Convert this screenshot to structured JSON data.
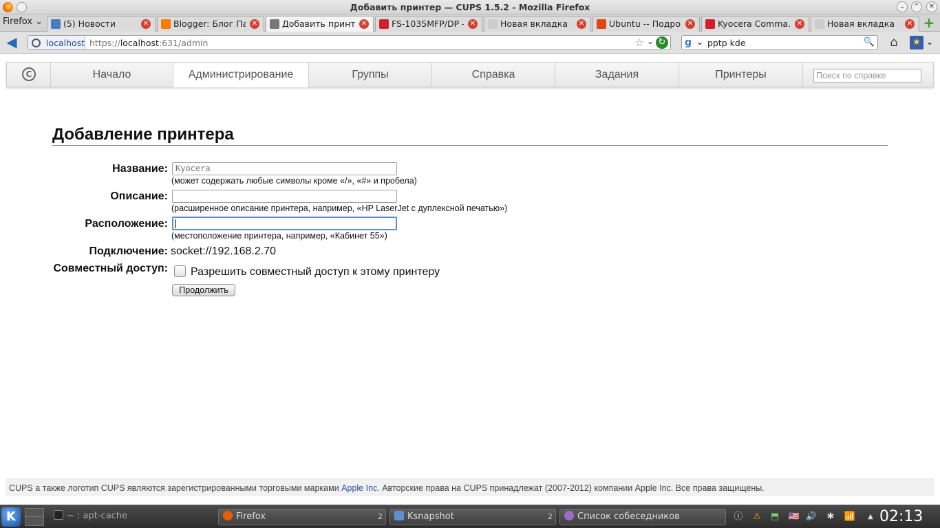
{
  "window": {
    "title": "Добавить принтер — CUPS 1.5.2 - Mozilla Firefox",
    "buttons": [
      "⌄",
      "⌃",
      "✕"
    ]
  },
  "tabs": {
    "menu_label": "Firefox ⌄",
    "items": [
      {
        "label": "(5) Новости",
        "favicon_color": "#4b7bc5"
      },
      {
        "label": "Blogger: Блог Па…",
        "favicon_color": "#f57d00"
      },
      {
        "label": "Добавить принт…",
        "favicon_color": "#777777"
      },
      {
        "label": "FS-1035MFP/DP -…",
        "favicon_color": "#d0202a"
      },
      {
        "label": "Новая вкладка",
        "favicon_color": "#cccccc"
      },
      {
        "label": "Ubuntu -- Подро…",
        "favicon_color": "#dd4814"
      },
      {
        "label": "Kyocera Comma…",
        "favicon_color": "#d0202a"
      },
      {
        "label": "Новая вкладка",
        "favicon_color": "#cccccc"
      }
    ],
    "close_glyph": "✕",
    "new_tab_glyph": "+"
  },
  "navbar": {
    "back_icon": "◀",
    "identity_host": "localhost",
    "url_scheme": "https://",
    "url_host": "localhost",
    "url_rest": ":631/admin",
    "star_icon": "☆",
    "drop_icon": "⌄",
    "reload_icon": "↻",
    "search_engine_icon": "g",
    "search_query": "pptp kde",
    "search_go_icon": "🔍",
    "home_icon": "⌂",
    "bookmarks_icon": "★"
  },
  "cups_nav": {
    "items": [
      "Начало",
      "Администрирование",
      "Группы",
      "Справка",
      "Задания",
      "Принтеры"
    ],
    "active_index": 1,
    "search_placeholder": "Поиск по справке"
  },
  "form": {
    "heading": "Добавление принтера",
    "name_label": "Название:",
    "name_value": "Kyocera",
    "name_hint": "(может содержать любые символы кроме «/», «#» и пробела)",
    "description_label": "Описание:",
    "description_value": "",
    "description_hint": "(расширенное описание принтера, например, «HP LaserJet с дуплексной печатью»)",
    "location_label": "Расположение:",
    "location_value": "",
    "location_hint": "(местоположение принтера, например, «Кабинет 55»)",
    "connection_label": "Подключение:",
    "connection_value": "socket://192.168.2.70",
    "sharing_label": "Совместный доступ:",
    "sharing_checkbox_label": "Разрешить совместный доступ к этому принтеру",
    "sharing_checked": false,
    "continue_button": "Продолжить"
  },
  "footer": {
    "text_before": "CUPS а также логотип CUPS являются зарегистрированными торговыми марками ",
    "link": "Apple Inc.",
    "text_after": " Авторские права на CUPS принадлежат (2007-2012) компании Apple Inc. Все права защищены."
  },
  "taskbar": {
    "kmenu_icon": "K",
    "tasks": [
      {
        "label": "~ : apt-cache",
        "icon_color": "#222222"
      },
      {
        "label": "Firefox",
        "icon_color": "#e66000",
        "count": "2"
      },
      {
        "label": "Ksnapshot",
        "icon_color": "#5b8fd3",
        "count": "2"
      },
      {
        "label": "Список собеседников",
        "icon_color": "#9b6cc9"
      }
    ],
    "tray_icons": [
      "ⓘ",
      "⚠",
      "⬒",
      "🇺🇸",
      "🔊",
      "✱",
      "📶",
      "▲"
    ],
    "clock": "02:13"
  }
}
